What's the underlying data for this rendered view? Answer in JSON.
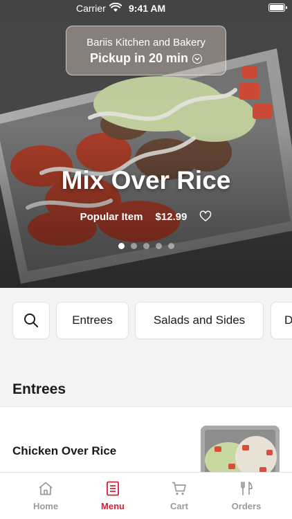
{
  "status_bar": {
    "carrier": "Carrier",
    "time": "9:41 AM"
  },
  "pickup": {
    "restaurant": "Bariis Kitchen and Bakery",
    "time_label": "Pickup in 20 min"
  },
  "hero": {
    "title": "Mix Over Rice",
    "badge": "Popular Item",
    "price": "$12.99",
    "slide_count": 5,
    "active_slide": 1
  },
  "categories": [
    {
      "label": "Entrees"
    },
    {
      "label": "Salads and Sides"
    },
    {
      "label": "Drinks"
    }
  ],
  "section": {
    "title": "Entrees"
  },
  "items": [
    {
      "name": "Chicken Over Rice"
    }
  ],
  "tabs": [
    {
      "label": "Home",
      "icon": "home-icon"
    },
    {
      "label": "Menu",
      "icon": "menu-icon",
      "active": true
    },
    {
      "label": "Cart",
      "icon": "cart-icon"
    },
    {
      "label": "Orders",
      "icon": "orders-icon"
    }
  ],
  "colors": {
    "accent": "#d81f34",
    "inactive": "#9a9a9a"
  }
}
